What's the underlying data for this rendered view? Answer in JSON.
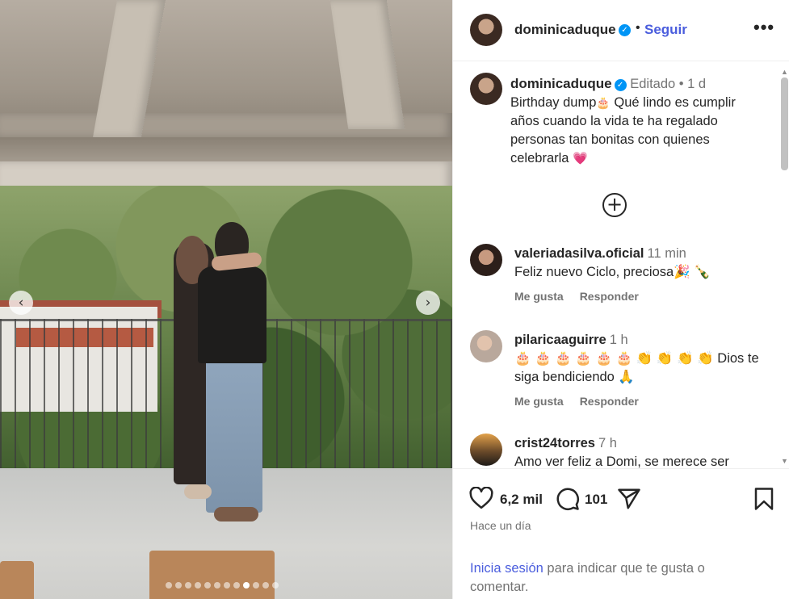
{
  "carousel": {
    "total_slides": 12,
    "active_index": 8,
    "prev_arrow": "‹",
    "next_arrow": "›"
  },
  "post": {
    "author": "dominicaduque",
    "verified_mark": "✓",
    "separator": "•",
    "follow_label": "Seguir",
    "more_label": "•••",
    "caption": {
      "username": "dominicaduque",
      "edited_label": "Editado",
      "dot": "•",
      "time": "1 d",
      "text_before_emoji": "Birthday dump",
      "cake_emoji": "🎂",
      "text_after_emoji": " Qué lindo es cumplir años cuando la vida te ha regalado personas tan bonitas con quienes celebrarla ",
      "heart_emoji": "💗"
    },
    "load_more_label": "+",
    "comments": [
      {
        "username": "valeriadasilva.oficial",
        "time": "11 min",
        "text": "Feliz nuevo Ciclo, preciosa🎉 🍾",
        "like_label": "Me gusta",
        "reply_label": "Responder"
      },
      {
        "username": "pilaricaaguirre",
        "time": "1 h",
        "text": "🎂 🎂 🎂 🎂 🎂 🎂 👏 👏 👏 👏 Dios te siga bendiciendo 🙏",
        "like_label": "Me gusta",
        "reply_label": "Responder"
      },
      {
        "username": "crist24torres",
        "time": "7 h",
        "text": "Amo ver feliz a Domi, se merece ser"
      }
    ],
    "likes_count": "6,2 mil",
    "comments_count": "101",
    "date_label": "Hace un día",
    "login_link": "Inicia sesión",
    "login_rest": " para indicar que te gusta o comentar."
  },
  "colors": {
    "accent": "#4a5ddd",
    "verified": "#0095f6",
    "muted": "#737373",
    "text": "#262626"
  },
  "icons": {
    "like": "heart-outline-icon",
    "comment": "speech-bubble-icon",
    "share": "paper-plane-icon",
    "save": "bookmark-icon",
    "more": "more-options-icon",
    "add": "plus-circle-icon"
  }
}
